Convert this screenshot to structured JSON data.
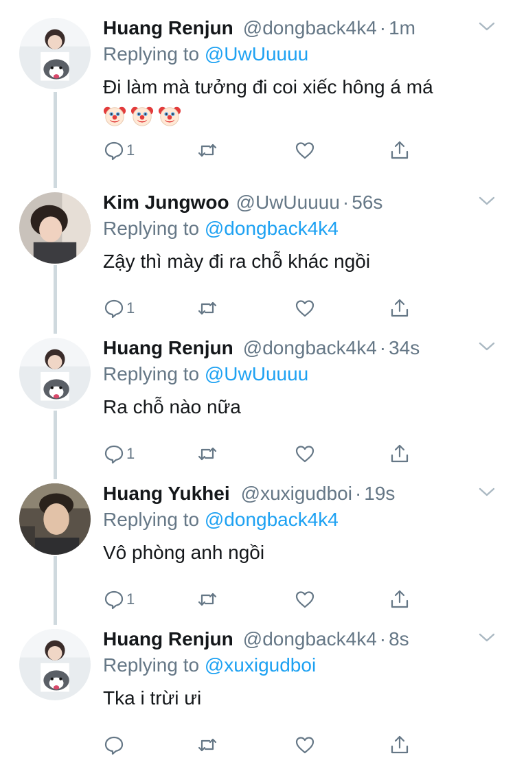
{
  "reply_prefix": "Replying to ",
  "colors": {
    "name": "#14171a",
    "meta": "#657786",
    "link": "#1da1f2",
    "thread_line": "#cfd9de"
  },
  "icons": {
    "reply": "comment-icon",
    "retweet": "retweet-icon",
    "like": "heart-icon",
    "share": "share-icon",
    "menu": "chevron-down-icon"
  },
  "tweets": [
    {
      "name": "Huang Renjun",
      "handle": "@dongback4k4",
      "dot": "·",
      "time": "1m",
      "reply_to": "@UwUuuuu",
      "text": "Đi làm mà tưởng đi coi xiếc hông á má",
      "emojis": [
        "clown-face",
        "clown-face",
        "clown-face"
      ],
      "reply_count": "1"
    },
    {
      "name": "Kim Jungwoo",
      "handle": "@UwUuuuu",
      "dot": "·",
      "time": "56s",
      "reply_to": "@dongback4k4",
      "text": "Zậy thì mày đi ra chỗ khác ngồi",
      "reply_count": "1"
    },
    {
      "name": "Huang Renjun",
      "handle": "@dongback4k4",
      "dot": "·",
      "time": "34s",
      "reply_to": "@UwUuuuu",
      "text": "Ra chỗ nào nữa",
      "reply_count": "1"
    },
    {
      "name": "Huang Yukhei",
      "handle": "@xuxigudboi",
      "dot": "·",
      "time": "19s",
      "reply_to": "@dongback4k4",
      "text": "Vô phòng anh ngồi",
      "reply_count": "1"
    },
    {
      "name": "Huang Renjun",
      "handle": "@dongback4k4",
      "dot": "·",
      "time": "8s",
      "reply_to": "@xuxigudboi",
      "text": "Tka i trừi ưi",
      "reply_count": ""
    }
  ]
}
